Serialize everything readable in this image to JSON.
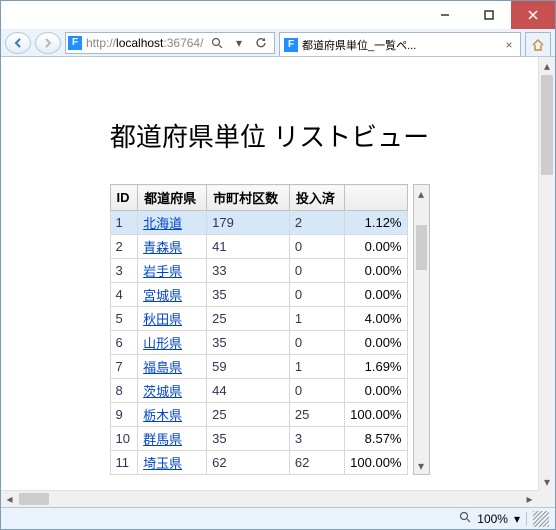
{
  "url_prefix": "http://",
  "url_host": "localhost",
  "url_port": ":36764/",
  "tab_title": "都道府県単位_一覧ペ...",
  "page_heading": "都道府県単位 リストビュー",
  "columns": [
    "ID",
    "都道府県",
    "市町村区数",
    "投入済",
    ""
  ],
  "rows": [
    {
      "id": "1",
      "pref": "北海道",
      "count": "179",
      "done": "2",
      "pct": "1.12%",
      "sel": true
    },
    {
      "id": "2",
      "pref": "青森県",
      "count": "41",
      "done": "0",
      "pct": "0.00%"
    },
    {
      "id": "3",
      "pref": "岩手県",
      "count": "33",
      "done": "0",
      "pct": "0.00%"
    },
    {
      "id": "4",
      "pref": "宮城県",
      "count": "35",
      "done": "0",
      "pct": "0.00%"
    },
    {
      "id": "5",
      "pref": "秋田県",
      "count": "25",
      "done": "1",
      "pct": "4.00%"
    },
    {
      "id": "6",
      "pref": "山形県",
      "count": "35",
      "done": "0",
      "pct": "0.00%"
    },
    {
      "id": "7",
      "pref": "福島県",
      "count": "59",
      "done": "1",
      "pct": "1.69%"
    },
    {
      "id": "8",
      "pref": "茨城県",
      "count": "44",
      "done": "0",
      "pct": "0.00%"
    },
    {
      "id": "9",
      "pref": "栃木県",
      "count": "25",
      "done": "25",
      "pct": "100.00%"
    },
    {
      "id": "10",
      "pref": "群馬県",
      "count": "35",
      "done": "3",
      "pct": "8.57%"
    },
    {
      "id": "11",
      "pref": "埼玉県",
      "count": "62",
      "done": "62",
      "pct": "100.00%"
    }
  ],
  "zoom_label": "100%"
}
